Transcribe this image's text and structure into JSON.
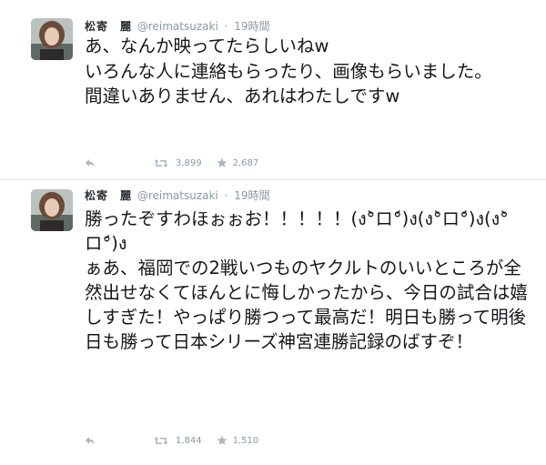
{
  "tweets": [
    {
      "name": "松寄　麗",
      "screen_name": "@reimatsuzaki",
      "separator": "·",
      "time": "19時間",
      "text": "あ、なんか映ってたらしいねw\nいろんな人に連絡もらったり、画像もらいました。\n間違いありません、あれはわたしですw",
      "retweets": "3,899",
      "favorites": "2,687"
    },
    {
      "name": "松寄　麗",
      "screen_name": "@reimatsuzaki",
      "separator": "·",
      "time": "19時間",
      "text": "勝ったぞすわほぉぉお！！！！！(ง°̀ロ°́)ง(ง°̀ロ°́)ง(ง°̀ロ°́)ง\nぁあ、福岡での2戦いつものヤクルトのいいところが全然出せなくてほんとに悔しかったから、今日の試合は嬉しすぎた！やっぱり勝つって最高だ！明日も勝って明後日も勝って日本シリーズ神宮連勝記録のばすぞ！",
      "retweets": "1,844",
      "favorites": "1,510"
    }
  ],
  "icons": {
    "reply": "reply-icon",
    "retweet": "retweet-icon",
    "favorite": "star-icon"
  },
  "colors": {
    "muted": "#8899a6",
    "text": "#14171a",
    "divider": "#e1e8ed"
  }
}
